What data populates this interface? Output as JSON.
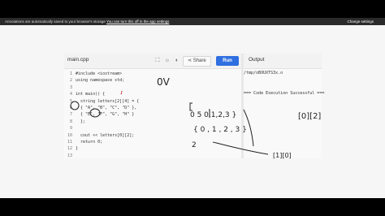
{
  "banner": {
    "text": "Annotations are automatically saved to your browser's storage",
    "link": "You can turn this off in the app settings",
    "change_settings": "Change settings"
  },
  "editor": {
    "file_name": "main.cpp",
    "share_label": "Share",
    "run_label": "Run",
    "icons": [
      "fullscreen-icon",
      "brightness-icon",
      "theme-icon",
      "share-icon"
    ],
    "lines": [
      {
        "no": "1",
        "code": "#include <iostream>"
      },
      {
        "no": "2",
        "code": "using namespace std;"
      },
      {
        "no": "3",
        "code": ""
      },
      {
        "no": "4",
        "code": "int main() {"
      },
      {
        "no": "5",
        "code": "  string letters[2][4] = {"
      },
      {
        "no": "6",
        "code": "  { \"A\", \"B\", \"C\", \"D\" },"
      },
      {
        "no": "7",
        "code": "  { \"E\", \"F\", \"G\", \"H\" }"
      },
      {
        "no": "8",
        "code": "  };"
      },
      {
        "no": "9",
        "code": ""
      },
      {
        "no": "10",
        "code": "  cout << letters[0][2];"
      },
      {
        "no": "11",
        "code": "  return 0;"
      },
      {
        "no": "12",
        "code": "}"
      },
      {
        "no": "13",
        "code": ""
      }
    ]
  },
  "output": {
    "title": "Output",
    "lines": [
      "/tmp/oBOUXTS3x.o",
      "",
      "",
      "=== Code Execution Successful ==="
    ]
  },
  "annotations": {
    "texts": [
      "0V",
      "[0][2]",
      "[1][0]",
      "2",
      "3",
      "1"
    ]
  },
  "colors": {
    "run": "#2f6fe0",
    "background": "#f6f6f6"
  }
}
